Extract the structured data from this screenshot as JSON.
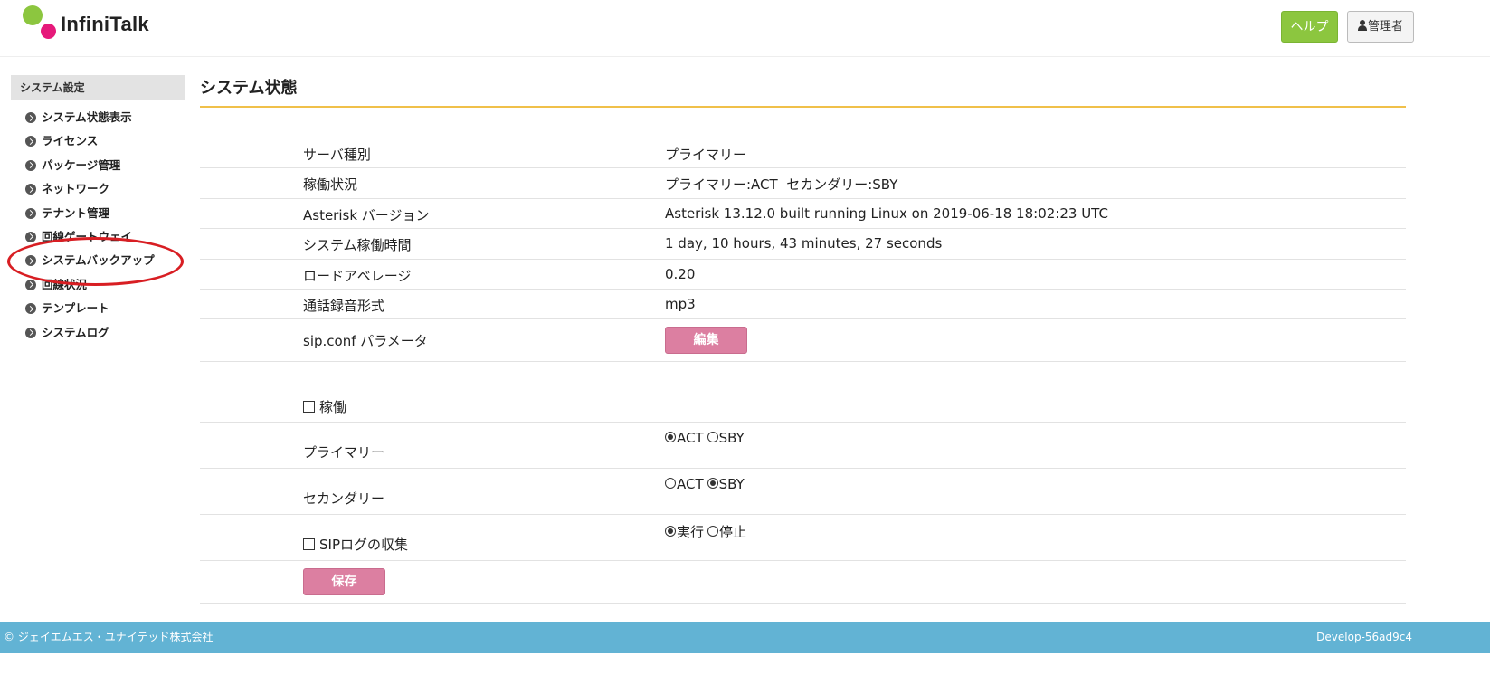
{
  "header": {
    "logo_text": "InfiniTalk",
    "help_label": "ヘルプ",
    "admin_label": "管理者"
  },
  "sidebar": {
    "title": "システム設定",
    "items": [
      {
        "label": "システム状態表示"
      },
      {
        "label": "ライセンス"
      },
      {
        "label": "パッケージ管理"
      },
      {
        "label": "ネットワーク"
      },
      {
        "label": "テナント管理"
      },
      {
        "label": "回線ゲートウェイ"
      },
      {
        "label": "システムバックアップ"
      },
      {
        "label": "回線状況"
      },
      {
        "label": "テンプレート"
      },
      {
        "label": "システムログ"
      }
    ]
  },
  "main": {
    "title": "システム状態",
    "info_rows": [
      {
        "label": "サーバ種別",
        "value": "プライマリー"
      },
      {
        "label": "稼働状況",
        "value": "プライマリー:ACT  セカンダリー:SBY"
      },
      {
        "label": "Asterisk バージョン",
        "value": "Asterisk 13.12.0 built running Linux on 2019-06-18 18:02:23 UTC"
      },
      {
        "label": "システム稼働時間",
        "value": "1 day, 10 hours, 43 minutes, 27 seconds"
      },
      {
        "label": "ロードアベレージ",
        "value": "0.20"
      },
      {
        "label": "通話録音形式",
        "value": "mp3"
      }
    ],
    "sip_conf": {
      "label": "sip.conf パラメータ",
      "button": "編集"
    },
    "controls": {
      "operation_label": "稼働",
      "primary": {
        "label": "プライマリー",
        "opt1": "ACT",
        "opt2": "SBY",
        "selected": "ACT"
      },
      "secondary": {
        "label": "セカンダリー",
        "opt1": "ACT",
        "opt2": "SBY",
        "selected": "SBY"
      },
      "siplog": {
        "label": "SIPログの収集",
        "opt1": "実行",
        "opt2": "停止",
        "selected": "実行"
      },
      "save_button": "保存"
    }
  },
  "footer": {
    "copyright": "© ジェイエムエス・ユナイテッド株式会社",
    "version": "Develop-56ad9c4"
  },
  "colors": {
    "accent_green": "#8cc63f",
    "accent_pink": "#dc7fa1",
    "title_underline": "#f0c04a",
    "footer_bg": "#62b3d4",
    "annotation_red": "#d81e23"
  }
}
